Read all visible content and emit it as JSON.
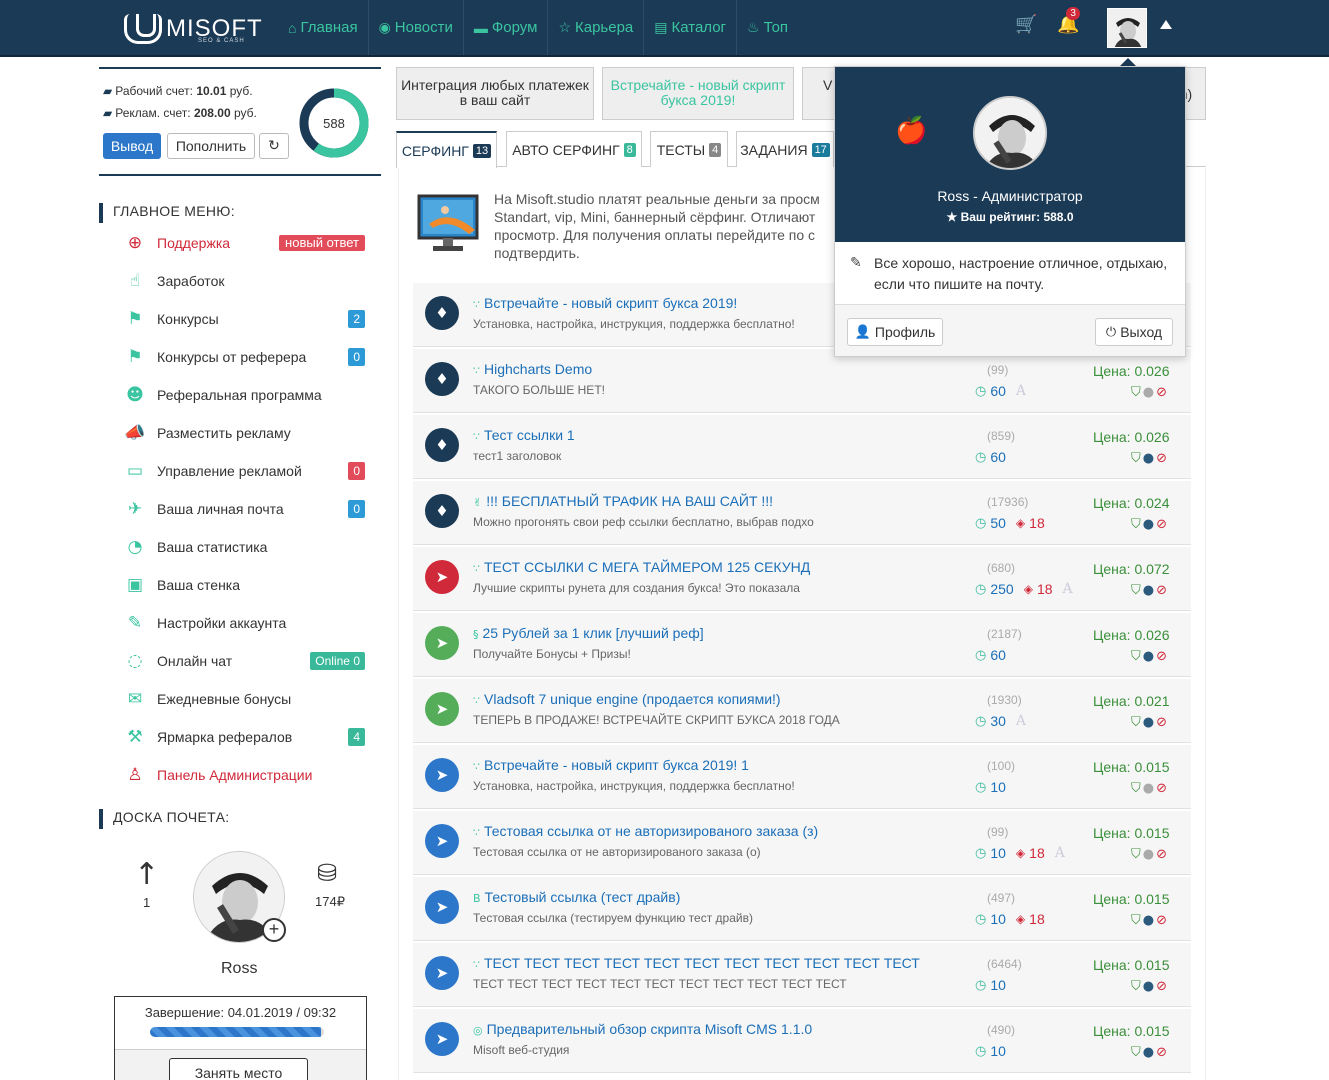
{
  "brand": {
    "name": "MISOFT",
    "sub": "SEO & CASH"
  },
  "nav": [
    {
      "icon": "⌂",
      "label": "Главная"
    },
    {
      "icon": "◉",
      "label": "Новости"
    },
    {
      "icon": "▬",
      "label": "Форум"
    },
    {
      "icon": "☆",
      "label": "Карьера"
    },
    {
      "icon": "▤",
      "label": "Каталог"
    },
    {
      "icon": "♨",
      "label": "Топ"
    }
  ],
  "top": {
    "cart_icon": "🛒",
    "bell_icon": "🔔",
    "notifications": "3"
  },
  "account": {
    "work_label": "Рабочий счет:",
    "work_value": "10.01",
    "work_unit": "руб.",
    "ad_label": "Реклам. счет:",
    "ad_value": "208.00",
    "ad_unit": "руб.",
    "withdraw": "Вывод",
    "topup": "Пополнить",
    "refresh_icon": "↻",
    "rating": "588",
    "rating_fraction": 0.6
  },
  "main_menu_title": "ГЛАВНОЕ МЕНЮ:",
  "menu": [
    {
      "icon": "⊕",
      "label": "Поддержка",
      "badge": "новый ответ",
      "badge_color": "pink",
      "red": true
    },
    {
      "icon": "☝",
      "label": "Заработок",
      "badge": "",
      "badge_color": "",
      "red": false
    },
    {
      "icon": "⚑",
      "label": "Конкурсы",
      "badge": "2",
      "badge_color": "blue",
      "red": false
    },
    {
      "icon": "⚑",
      "label": "Конкурсы от реферера",
      "badge": "0",
      "badge_color": "blue",
      "red": false
    },
    {
      "icon": "☻",
      "label": "Реферальная программа",
      "badge": "",
      "badge_color": "",
      "red": false
    },
    {
      "icon": "📣",
      "label": "Разместить рекламу",
      "badge": "",
      "badge_color": "",
      "red": false
    },
    {
      "icon": "▭",
      "label": "Управление рекламой",
      "badge": "0",
      "badge_color": "red",
      "red": false
    },
    {
      "icon": "✈",
      "label": "Ваша личная почта",
      "badge": "0",
      "badge_color": "blue",
      "red": false
    },
    {
      "icon": "◔",
      "label": "Ваша статистика",
      "badge": "",
      "badge_color": "",
      "red": false
    },
    {
      "icon": "▣",
      "label": "Ваша стенка",
      "badge": "",
      "badge_color": "",
      "red": false
    },
    {
      "icon": "✎",
      "label": "Настройки аккаунта",
      "badge": "",
      "badge_color": "",
      "red": false
    },
    {
      "icon": "◌",
      "label": "Онлайн чат",
      "badge": "Online 0",
      "badge_color": "green",
      "red": false
    },
    {
      "icon": "✉",
      "label": "Ежедневные бонусы",
      "badge": "",
      "badge_color": "",
      "red": false
    },
    {
      "icon": "⚒",
      "label": "Ярмарка рефералов",
      "badge": "4",
      "badge_color": "green",
      "red": false
    },
    {
      "icon": "♙",
      "label": "Панель Администрации",
      "badge": "",
      "badge_color": "",
      "red": true
    }
  ],
  "honor": {
    "title": "ДОСКА ПОЧЕТА:",
    "rank": "1",
    "amount": "174₽",
    "name": "Ross",
    "end_label": "Завершение: 04.01.2019 / 09:32",
    "progress": 0.98,
    "occupy": "Занять место"
  },
  "promos": [
    {
      "text": "Интеграция любых платежек в ваш сайт",
      "green": false
    },
    {
      "text": "Встречайте - новый скрипт букса 2019!",
      "green": true
    },
    {
      "text": "V (",
      "green": false
    },
    {
      "text": "n)",
      "green": false
    }
  ],
  "tabs": [
    {
      "label": "СЕРФИНГ",
      "count": "13",
      "color": "navy",
      "active": true
    },
    {
      "label": "АВТО СЕРФИНГ",
      "count": "8",
      "color": "green",
      "active": false
    },
    {
      "label": "ТЕСТЫ",
      "count": "4",
      "color": "gray",
      "active": false
    },
    {
      "label": "ЗАДАНИЯ",
      "count": "17",
      "color": "teal",
      "active": false
    }
  ],
  "intro": "На Misoft.studio платят реальные деньги за просм Standart, vip, Mini, баннерный сёрфинг. Отличают просмотр. Для получения оплаты перейдите по с подтвердить.",
  "rows": [
    {
      "icon": "♦",
      "color": "navy",
      "title_icon": "∵",
      "title": "Встречайте - новый скрипт букса 2019!",
      "sub": "Установка, настройка, инструкция, поддержка бесплатно!",
      "views": "",
      "time": "",
      "eye": "",
      "aa": false,
      "price": "",
      "user_gray": false
    },
    {
      "icon": "♦",
      "color": "navy",
      "title_icon": "∵",
      "title": "Highcharts Demo",
      "sub": "ТАКОГО БОЛЬШЕ НЕТ!",
      "views": "(99)",
      "time": "60",
      "eye": "",
      "aa": true,
      "price": "Цена: 0.026",
      "user_gray": true
    },
    {
      "icon": "♦",
      "color": "navy",
      "title_icon": "∵",
      "title": "Тест ссылки 1",
      "sub": "тест1 заголовок",
      "views": "(859)",
      "time": "60",
      "eye": "",
      "aa": false,
      "price": "Цена: 0.026",
      "user_gray": false
    },
    {
      "icon": "♦",
      "color": "navy",
      "title_icon": "✌",
      "title": "!!! БЕСПЛАТНЫЙ ТРАФИК НА ВАШ САЙТ !!!",
      "sub": "Можно прогонять свои реф ссылки бесплатно, выбрав подхо",
      "views": "(17936)",
      "time": "50",
      "eye": "18",
      "aa": false,
      "price": "Цена: 0.024",
      "user_gray": false
    },
    {
      "icon": "➤",
      "color": "red",
      "title_icon": "∵",
      "title": "ТЕСТ ССЫЛКИ С МЕГА ТАЙМЕРОМ 125 СЕКУНД",
      "sub": "Лучшие скрипты рунета для создания букса! Это показала",
      "views": "(680)",
      "time": "250",
      "eye": "18",
      "aa": true,
      "price": "Цена: 0.072",
      "user_gray": false
    },
    {
      "icon": "➤",
      "color": "green",
      "title_icon": "§",
      "title": "25 Рублей за 1 клик [лучший реф]",
      "sub": "Получайте Бонусы + Призы!",
      "views": "(2187)",
      "time": "60",
      "eye": "",
      "aa": false,
      "price": "Цена: 0.026",
      "user_gray": false
    },
    {
      "icon": "➤",
      "color": "green",
      "title_icon": "∵",
      "title": "Vladsoft 7 unique engine (продается копиями!)",
      "sub": "ТЕПЕРЬ В ПРОДАЖЕ! ВСТРЕЧАЙТЕ СКРИПТ БУКСА 2018 ГОДА",
      "views": "(1930)",
      "time": "30",
      "eye": "",
      "aa": true,
      "price": "Цена: 0.021",
      "user_gray": false
    },
    {
      "icon": "➤",
      "color": "blue",
      "title_icon": "∵",
      "title": "Встречайте - новый скрипт букса 2019! 1",
      "sub": "Установка, настройка, инструкция, поддержка бесплатно!",
      "views": "(100)",
      "time": "10",
      "eye": "",
      "aa": false,
      "price": "Цена: 0.015",
      "user_gray": true
    },
    {
      "icon": "➤",
      "color": "blue",
      "title_icon": "∵",
      "title": "Тестовая ссылка от не авторизированого заказа (з)",
      "sub": "Тестовая ссылка от не авторизированого заказа (о)",
      "views": "(99)",
      "time": "10",
      "eye": "18",
      "aa": true,
      "price": "Цена: 0.015",
      "user_gray": true
    },
    {
      "icon": "➤",
      "color": "blue",
      "title_icon": "B",
      "title": "Тестовый ссылка (тест драйв)",
      "sub": "Тестовая ссылка (тестируем функцию тест драйв)",
      "views": "(497)",
      "time": "10",
      "eye": "18",
      "aa": false,
      "price": "Цена: 0.015",
      "user_gray": false
    },
    {
      "icon": "➤",
      "color": "blue",
      "title_icon": "∵",
      "title": "ТЕСТ ТЕСТ ТЕСТ ТЕСТ ТЕСТ ТЕСТ ТЕСТ ТЕСТ ТЕСТ ТЕСТ ТЕСТ",
      "sub": "ТЕСТ ТЕСТ ТЕСТ ТЕСТ ТЕСТ ТЕСТ ТЕСТ ТЕСТ ТЕСТ ТЕСТ ТЕСТ",
      "views": "(6464)",
      "time": "10",
      "eye": "",
      "aa": false,
      "price": "Цена: 0.015",
      "user_gray": false
    },
    {
      "icon": "➤",
      "color": "blue",
      "title_icon": "◎",
      "title": "Предварительный обзор скрипта Misoft CMS 1.1.0",
      "sub": "Misoft веб-студия",
      "views": "(490)",
      "time": "10",
      "eye": "",
      "aa": false,
      "price": "Цена: 0.015",
      "user_gray": false
    }
  ],
  "dropdown": {
    "apple_icon": "🍎",
    "name": "Ross - Администратор",
    "rating": "★ Ваш рейтинг: 588.0",
    "pen_icon": "✎",
    "status": "Все хорошо, настроение отличное, отдыхаю, если что пишите на почту.",
    "profile_icon": "👤",
    "profile": "Профиль",
    "logout_icon": "⏻",
    "logout": "Выход"
  },
  "colors": {
    "navy": "#1b3a56",
    "accent": "#3ac49f",
    "red": "#d0293a",
    "link": "#1b6fb8"
  }
}
